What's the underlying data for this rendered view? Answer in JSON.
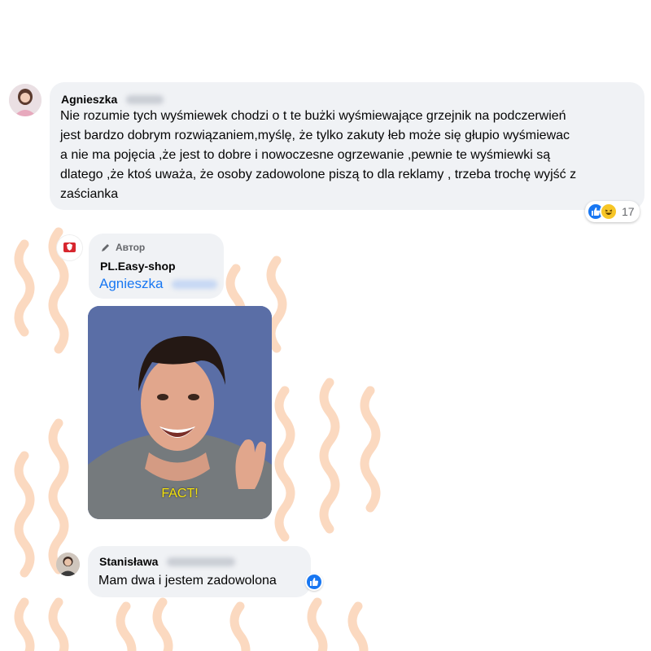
{
  "comment1": {
    "author_first": "Agnieszka",
    "text": "Nie rozumie tych wyśmiewek chodzi o t te bużki wyśmiewające grzejnik na podczerwień jest bardzo dobrym rozwiązaniem,myślę, że tylko zakuty łeb może się głupio wyśmiewac a nie ma pojęcia ,że jest to dobre i nowoczesne ogrzewanie ,pewnie te wyśmiewki są dlatego ,że ktoś uważa, że osoby zadowolone piszą to dla reklamy , trzeba trochę wyjść z zaścianka",
    "reactions": {
      "icons": [
        "like-icon",
        "haha-icon"
      ],
      "count": "17"
    }
  },
  "reply": {
    "author_badge": "Автор",
    "author": "PL.Easy-shop",
    "mention": "Agnieszka",
    "gif": {
      "caption": "FACT!"
    }
  },
  "comment2": {
    "author_first": "Stanisława",
    "text": "Mam dwa i jestem zadowolona",
    "reactions": {
      "icons": [
        "like-icon"
      ]
    }
  },
  "colors": {
    "accent": "#1877f2",
    "bubble": "#f0f2f5",
    "wave": "#fbd9c0",
    "haha": "#f7c627"
  }
}
